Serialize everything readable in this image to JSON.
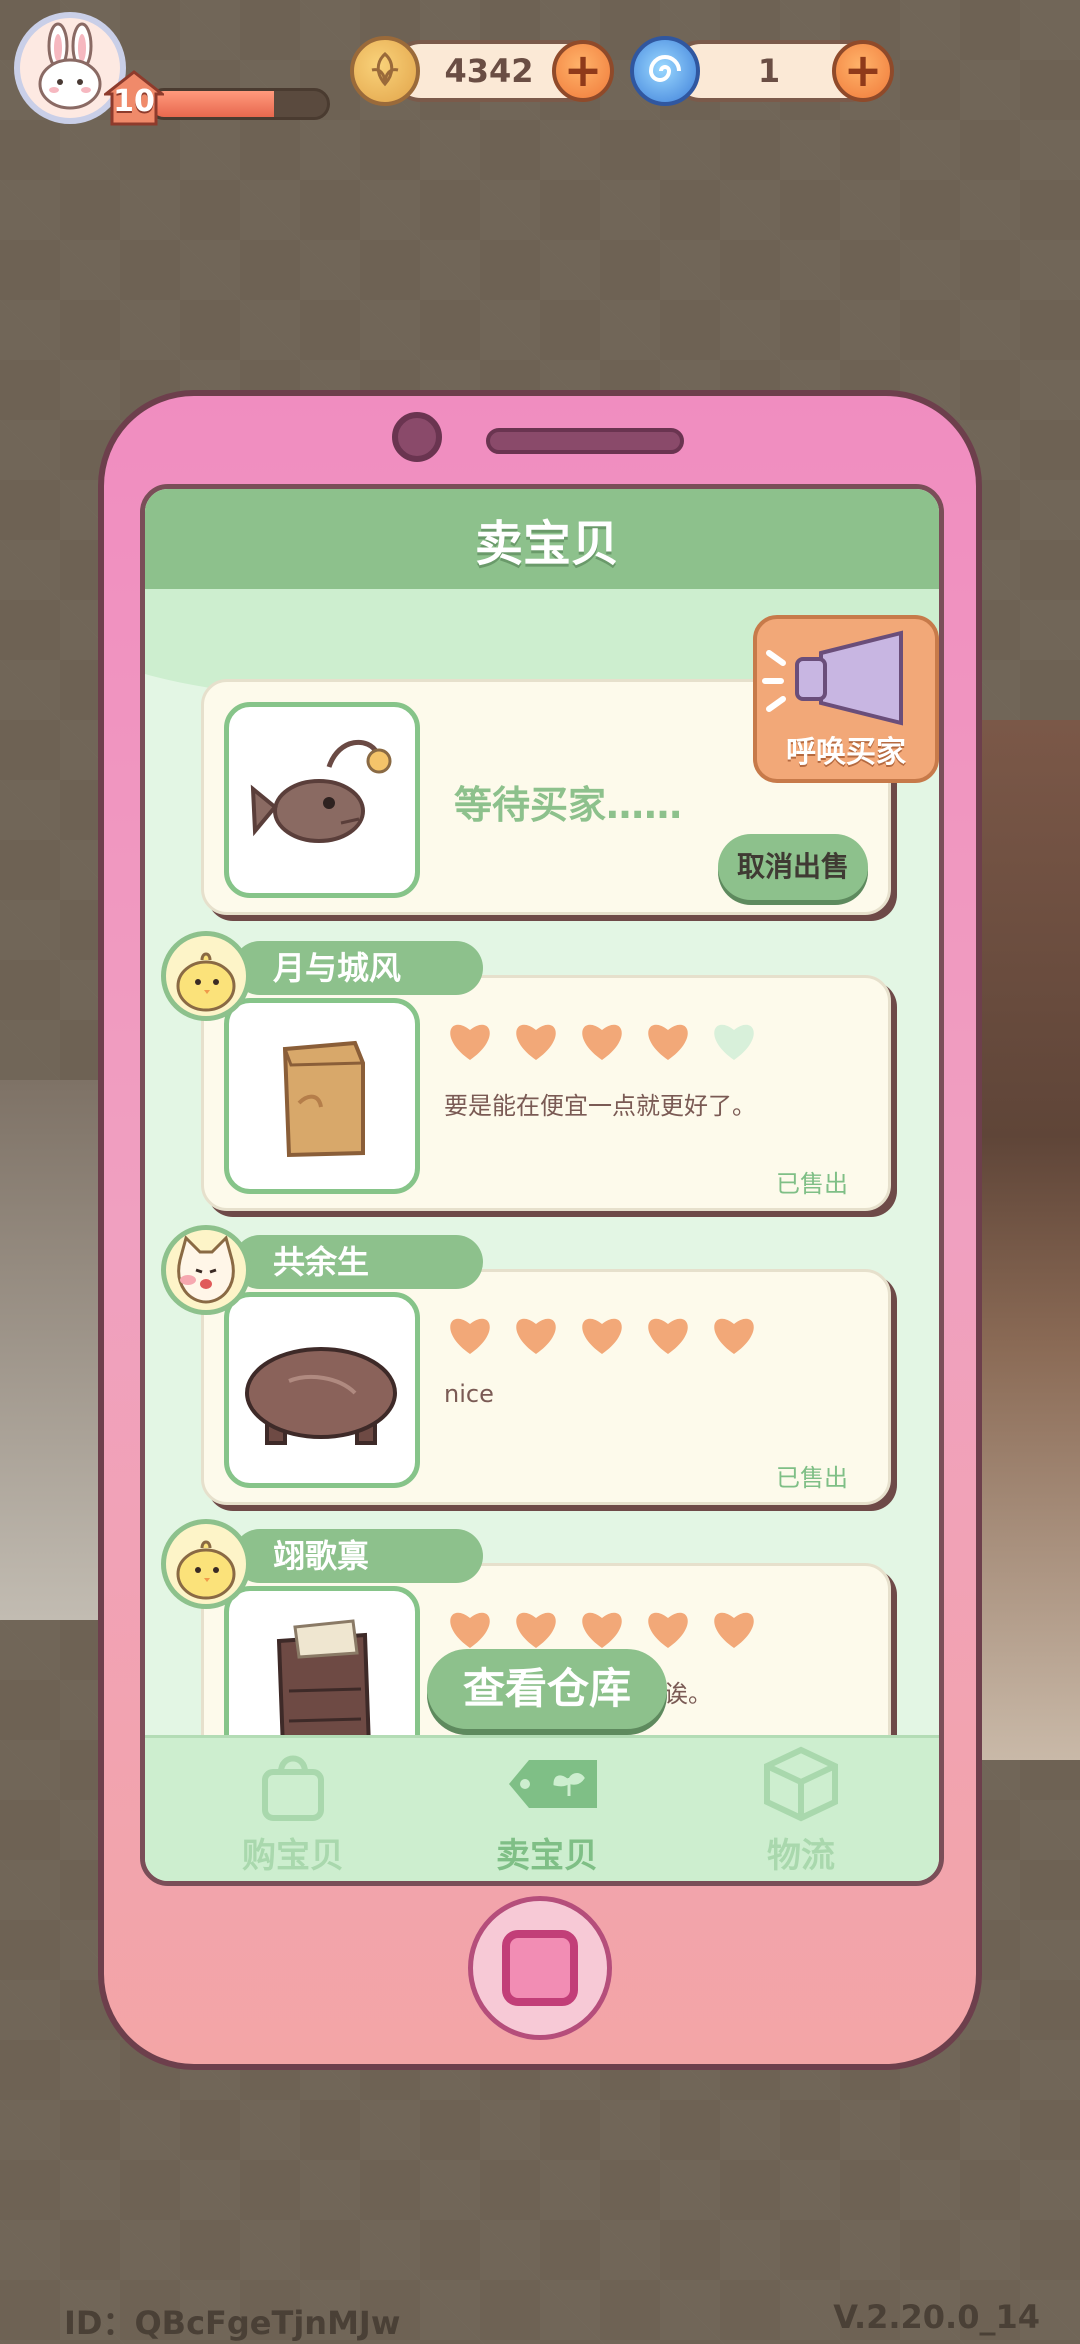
{
  "hud": {
    "level": "10",
    "xp_progress": 0.7,
    "coins": "4342",
    "gems": "1",
    "colors": {
      "coin": "#e2a44a",
      "gem": "#3e7fd9",
      "plus": "#f07a3a"
    }
  },
  "phone": {
    "title": "卖宝贝",
    "pending": {
      "status_text": "等待买家……",
      "cancel_label": "取消出售"
    },
    "call_buyer_label": "呼唤买家",
    "sold_items": [
      {
        "buyer": "月与城风",
        "avatar": "chick-avatar",
        "item": "cardboard-box",
        "rating": 4,
        "max_rating": 5,
        "comment": "要是能在便宜一点就更好了。",
        "status": "已售出"
      },
      {
        "buyer": "共余生",
        "avatar": "cat-avatar",
        "item": "round-wooden-table",
        "rating": 5,
        "max_rating": 5,
        "comment": "nice",
        "status": "已售出"
      },
      {
        "buyer": "翊歌禀",
        "avatar": "chick-avatar",
        "item": "wooden-cabinet",
        "rating": 5,
        "max_rating": 5,
        "comment": "诶。",
        "status": ""
      }
    ],
    "warehouse_label": "查看仓库",
    "nav": [
      {
        "label": "购宝贝",
        "icon": "shopping-bag-icon"
      },
      {
        "label": "卖宝贝",
        "icon": "sell-tag-icon"
      },
      {
        "label": "物流",
        "icon": "package-box-icon"
      }
    ],
    "accent": "#8dc18c"
  },
  "footer": {
    "id": "ID：QBcFgeTjnMJw",
    "version": "V.2.20.0_14"
  }
}
